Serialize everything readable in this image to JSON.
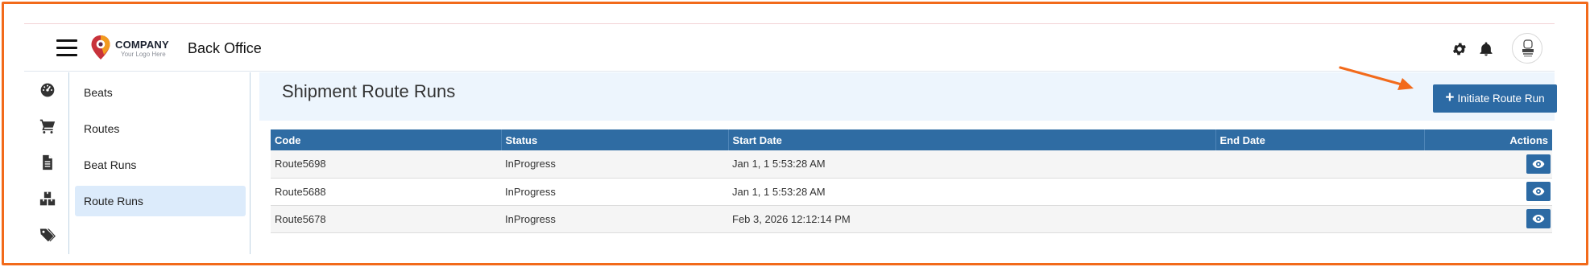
{
  "header": {
    "company_name": "COMPANY",
    "company_tagline": "Your Logo Here",
    "app_title": "Back Office"
  },
  "rail": {
    "items": [
      "dashboard-icon",
      "cart-icon",
      "document-icon",
      "boxes-icon",
      "tags-icon"
    ]
  },
  "submenu": {
    "items": [
      {
        "label": "Beats",
        "active": false
      },
      {
        "label": "Routes",
        "active": false
      },
      {
        "label": "Beat Runs",
        "active": false
      },
      {
        "label": "Route Runs",
        "active": true
      }
    ]
  },
  "main": {
    "title": "Shipment Route Runs",
    "initiate_label": "Initiate Route Run"
  },
  "table": {
    "columns": [
      "Code",
      "Status",
      "Start Date",
      "End Date",
      "Actions"
    ],
    "rows": [
      {
        "code": "Route5698",
        "status": "InProgress",
        "start": "Jan 1, 1 5:53:28 AM",
        "end": ""
      },
      {
        "code": "Route5688",
        "status": "InProgress",
        "start": "Jan 1, 1 5:53:28 AM",
        "end": ""
      },
      {
        "code": "Route5678",
        "status": "InProgress",
        "start": "Feb 3, 2026 12:12:14 PM",
        "end": ""
      }
    ]
  },
  "colors": {
    "accent": "#2c6aa4",
    "annotation": "#f26a1b",
    "active_menu": "#dcebfb"
  }
}
